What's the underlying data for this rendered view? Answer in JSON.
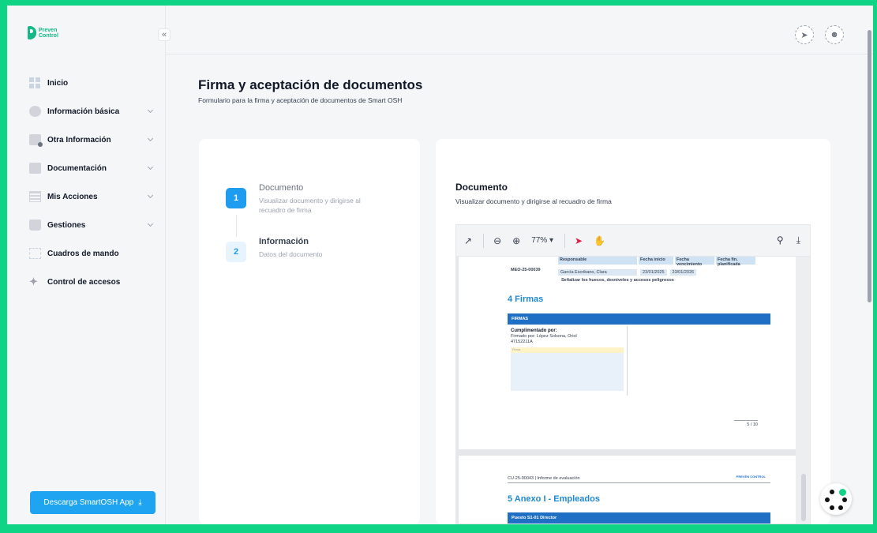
{
  "brand": {
    "line1": "Preven",
    "line2": "Control"
  },
  "sidebar": {
    "collapse_icon": "double-chevron-left-icon",
    "items": [
      {
        "label": "Inicio",
        "icon": "grid-icon",
        "has_chevron": false
      },
      {
        "label": "Información básica",
        "icon": "user-icon",
        "has_chevron": true
      },
      {
        "label": "Otra Información",
        "icon": "document-info-icon",
        "has_chevron": true
      },
      {
        "label": "Documentación",
        "icon": "pen-document-icon",
        "has_chevron": true
      },
      {
        "label": "Mis Acciones",
        "icon": "list-icon",
        "has_chevron": true
      },
      {
        "label": "Gestiones",
        "icon": "clipboard-icon",
        "has_chevron": true
      },
      {
        "label": "Cuadros de mando",
        "icon": "chart-icon",
        "has_chevron": false
      },
      {
        "label": "Control de accesos",
        "icon": "running-person-icon",
        "has_chevron": false
      }
    ],
    "download_label": "Descarga SmartOSH App"
  },
  "header": {
    "icons": [
      "rocket-icon",
      "user-avatar-icon"
    ]
  },
  "page": {
    "title": "Firma y aceptación de documentos",
    "subtitle": "Formulario para la firma y aceptación de documentos de Smart OSH"
  },
  "steps": [
    {
      "number": "1",
      "title": "Documento",
      "description": "Visualizar documento y dirigirse al recuadro de firma",
      "active": true
    },
    {
      "number": "2",
      "title": "Información",
      "description": "Datos del documento",
      "active": false
    }
  ],
  "document": {
    "title": "Documento",
    "subtitle": "Visualizar documento y dirigirse al recuadro de firma",
    "viewer": {
      "zoom": "77%",
      "page1": {
        "table_headers": [
          "Responsable",
          "Fecha inicio",
          "Fecha vencimiento",
          "Fecha fin. planificada"
        ],
        "code": "MEO-25-00039",
        "responsable": "García Escribano, Clara",
        "fecha_inicio": "23/01/2025",
        "fecha_vencimiento": "23/01/2026",
        "action_text": "Señalizar los huecos, desniveles y accesos peligrosos",
        "section_title": "4 Firmas",
        "firmas_bar": "FIRMAS",
        "cumplimentado": "Cumplimentado por:",
        "firmado_por": "Firmado por: López Solsona, Oriol",
        "dni": "47152211A",
        "sig_label": "Firma",
        "page_number": "5 / 10"
      },
      "page2": {
        "header": "CU-25-00043 | Informe de evaluación",
        "logo_text": "PREVEN CONTROL",
        "section_title": "5 Anexo I - Empleados",
        "bar": "Puesto S1-01 Director"
      }
    }
  }
}
